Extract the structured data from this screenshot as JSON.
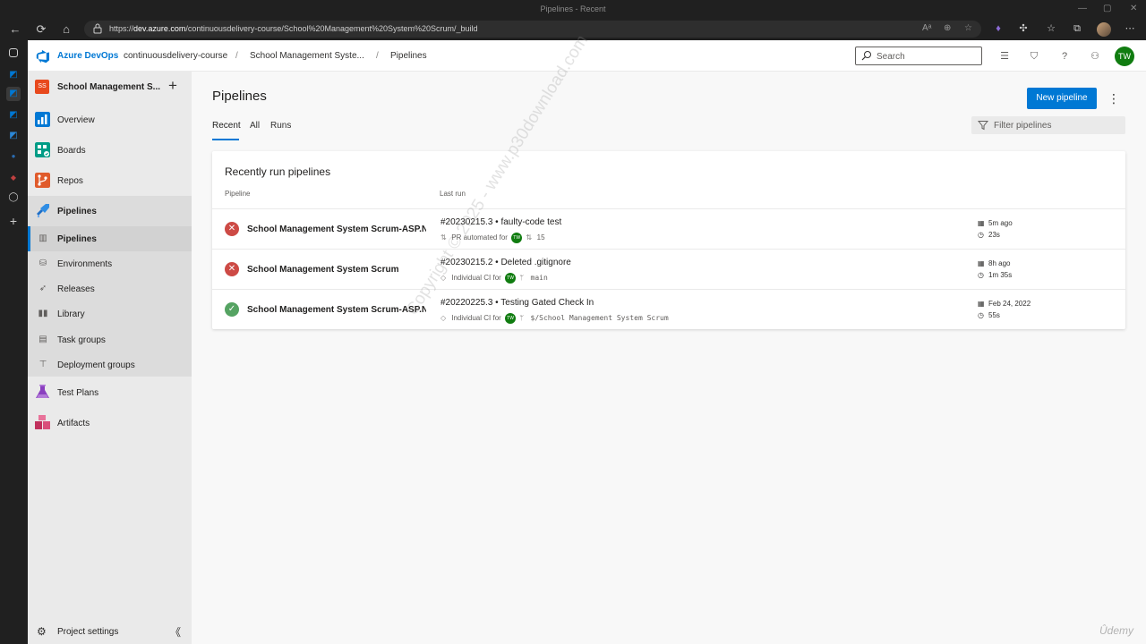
{
  "browser": {
    "window_title": "Pipelines - Recent",
    "url_prefix": "https://",
    "url_host": "dev.azure.com",
    "url_path": "/continuousdelivery-course/School%20Management%20System%20Scrum/_build",
    "profile_icon": "profile-avatar"
  },
  "header": {
    "brand": "Azure DevOps",
    "org": "continuousdelivery-course",
    "project": "School Management Syste...",
    "page": "Pipelines",
    "sep": "/",
    "search_placeholder": "Search",
    "user_initials": "TW",
    "accent_color": "#0078d4"
  },
  "sidebar": {
    "project_initials": "SS",
    "project_name": "School Management S...",
    "add_symbol": "+",
    "items": [
      {
        "label": "Overview",
        "icon": "overview-icon"
      },
      {
        "label": "Boards",
        "icon": "boards-icon"
      },
      {
        "label": "Repos",
        "icon": "repos-icon"
      },
      {
        "label": "Pipelines",
        "icon": "pipelines-icon"
      }
    ],
    "subitems": [
      {
        "label": "Pipelines",
        "icon": "pipelines-sub-icon"
      },
      {
        "label": "Environments",
        "icon": "environments-icon"
      },
      {
        "label": "Releases",
        "icon": "releases-icon"
      },
      {
        "label": "Library",
        "icon": "library-icon"
      },
      {
        "label": "Task groups",
        "icon": "task-groups-icon"
      },
      {
        "label": "Deployment groups",
        "icon": "deployment-groups-icon"
      }
    ],
    "items_bottom": [
      {
        "label": "Test Plans",
        "icon": "test-plans-icon"
      },
      {
        "label": "Artifacts",
        "icon": "artifacts-icon"
      }
    ],
    "settings_label": "Project settings",
    "collapse_symbol": "《"
  },
  "main": {
    "title": "Pipelines",
    "new_button": "New pipeline",
    "more": "⋮",
    "tabs": [
      "Recent",
      "All",
      "Runs"
    ],
    "filter_placeholder": "Filter pipelines",
    "card_title": "Recently run pipelines",
    "col_pipeline": "Pipeline",
    "col_last_run": "Last run",
    "rows": [
      {
        "status": "failed",
        "status_glyph": "✕",
        "name": "School Management System Scrum-ASP.N...",
        "run": "#20230215.3 • faulty-code test",
        "trigger": "PR automated for",
        "user": "TW",
        "ref_symbol": "⇅",
        "ref": "15",
        "when": "5m ago",
        "duration": "23s"
      },
      {
        "status": "failed",
        "status_glyph": "✕",
        "name": "School Management System Scrum",
        "run": "#20230215.2 • Deleted .gitignore",
        "trigger": "Individual CI for",
        "user": "TW",
        "ref_symbol": "ᛘ",
        "ref": "main",
        "when": "8h ago",
        "duration": "1m 35s"
      },
      {
        "status": "succeeded",
        "status_glyph": "✓",
        "name": "School Management System Scrum-ASP.N...",
        "run": "#20220225.3 • Testing Gated Check In",
        "trigger": "Individual CI for",
        "user": "TW",
        "ref_symbol": "ᛘ",
        "ref": "$/School Management System Scrum",
        "when": "Feb 24, 2022",
        "duration": "55s"
      }
    ]
  },
  "overlay": {
    "watermark": "Copyright © 2025 - www.p30download.com",
    "udemy": "Ûdemy"
  }
}
